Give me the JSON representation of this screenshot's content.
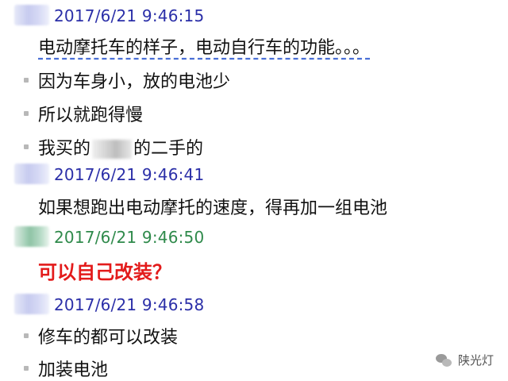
{
  "messages": [
    {
      "timestamp": "2017/6/21 9:46:15",
      "lines": [
        "电动摩托车的样子，电动自行车的功能。。。",
        "因为车身小，放的电池少",
        "所以就跑得慢",
        "我买的",
        "的二手的"
      ]
    },
    {
      "timestamp": "2017/6/21 9:46:41",
      "lines": [
        "如果想跑出电动摩托的速度，得再加一组电池"
      ]
    },
    {
      "timestamp": "2017/6/21 9:46:50",
      "lines": [
        "可以自己改装？"
      ]
    },
    {
      "timestamp": "2017/6/21 9:46:58",
      "lines": [
        "修车的都可以改装",
        "加装电池"
      ]
    }
  ],
  "watermark": {
    "text": "陕光灯",
    "icon": "wechat-icon"
  },
  "colors": {
    "timestamp": "#2b2fa8",
    "timestamp_alt": "#2f8a4b",
    "emphasis": "#e31b1b"
  }
}
